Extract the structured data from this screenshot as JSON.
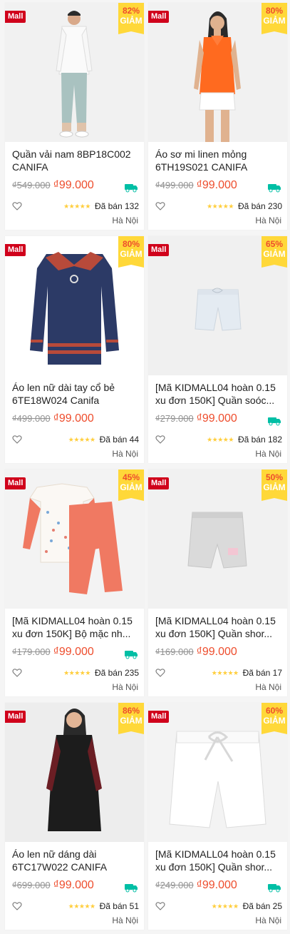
{
  "products": [
    {
      "name": "Quần vải nam 8BP18C002 CANIFA",
      "old_price": "₫549.000",
      "new_price": "₫99.000",
      "discount": "82%",
      "discount_label": "GIẢM",
      "mall": "Mall",
      "sold": "Đã bán 132",
      "location": "Hà Nội",
      "free_ship": true,
      "stars": "★★★★★",
      "img": "man"
    },
    {
      "name": "Áo sơ mi linen mỏng 6TH19S021 CANIFA",
      "old_price": "₫499.000",
      "new_price": "₫99.000",
      "discount": "80%",
      "discount_label": "GIẢM",
      "mall": "Mall",
      "sold": "Đã bán 230",
      "location": "Hà Nội",
      "free_ship": true,
      "stars": "★★★★★",
      "img": "orange"
    },
    {
      "name": "Áo len nữ dài tay cổ bẻ 6TE18W024 Canifa",
      "old_price": "₫499.000",
      "new_price": "₫99.000",
      "discount": "80%",
      "discount_label": "GIẢM",
      "mall": "Mall",
      "sold": "Đã bán 44",
      "location": "Hà Nội",
      "free_ship": false,
      "stars": "★★★★★",
      "img": "sweater"
    },
    {
      "name": "[Mã KIDMALL04 hoàn 0.15 xu đơn 150K] Quần soóc...",
      "old_price": "₫279.000",
      "new_price": "₫99.000",
      "discount": "65%",
      "discount_label": "GIẢM",
      "mall": "Mall",
      "sold": "Đã bán 182",
      "location": "Hà Nội",
      "free_ship": true,
      "stars": "★★★★★",
      "img": "shorts_blue"
    },
    {
      "name": "[Mã KIDMALL04 hoàn 0.15 xu đơn 150K] Bộ mặc nh...",
      "old_price": "₫179.000",
      "new_price": "₫99.000",
      "discount": "45%",
      "discount_label": "GIẢM",
      "mall": "Mall",
      "sold": "Đã bán 235",
      "location": "Hà Nội",
      "free_ship": true,
      "stars": "★★★★★",
      "img": "kidset"
    },
    {
      "name": "[Mã KIDMALL04 hoàn 0.15 xu đơn 150K] Quần shor...",
      "old_price": "₫169.000",
      "new_price": "₫99.000",
      "discount": "50%",
      "discount_label": "GIẢM",
      "mall": "Mall",
      "sold": "Đã bán 17",
      "location": "Hà Nội",
      "free_ship": false,
      "stars": "★★★★★",
      "img": "shorts_grey"
    },
    {
      "name": "Áo len nữ dáng dài 6TC17W022 CANIFA",
      "old_price": "₫699.000",
      "new_price": "₫99.000",
      "discount": "86%",
      "discount_label": "GIẢM",
      "mall": "Mall",
      "sold": "Đã bán 51",
      "location": "Hà Nội",
      "free_ship": true,
      "stars": "★★★★★",
      "img": "dress"
    },
    {
      "name": "[Mã KIDMALL04 hoàn 0.15 xu đơn 150K] Quần shor...",
      "old_price": "₫249.000",
      "new_price": "₫99.000",
      "discount": "60%",
      "discount_label": "GIẢM",
      "mall": "Mall",
      "sold": "Đã bán 25",
      "location": "Hà Nội",
      "free_ship": true,
      "stars": "★★★★★",
      "img": "shorts_white"
    }
  ],
  "colors": {
    "accent": "#ee4d2d",
    "mall_red": "#d0011b",
    "badge_yellow": "#ffd839",
    "free_ship_green": "#00bfa5",
    "star": "#ffce3d"
  }
}
